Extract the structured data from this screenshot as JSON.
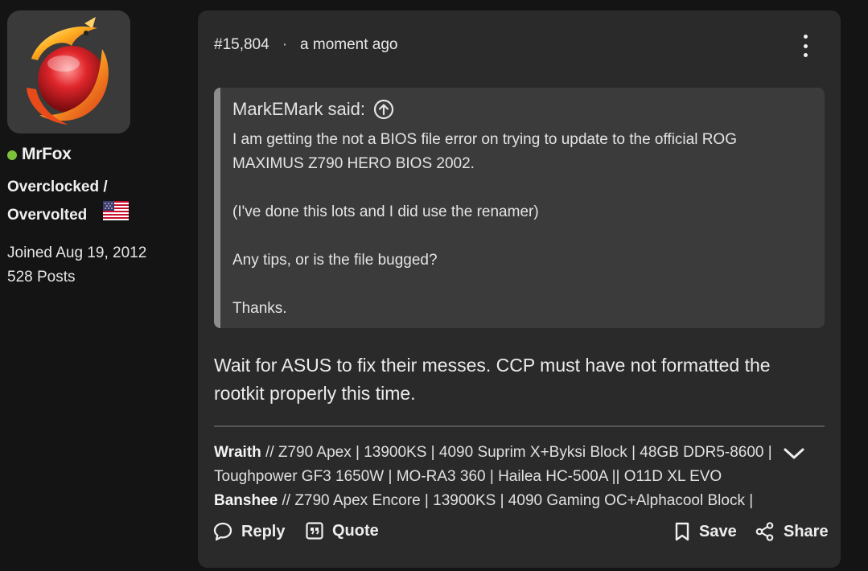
{
  "user": {
    "username": "MrFox",
    "online": true,
    "rank_line1": "Overclocked /",
    "rank_line2": "Overvolted",
    "joined": "Joined Aug 19, 2012",
    "posts": "528 Posts"
  },
  "post": {
    "number": "#15,804",
    "separator": "·",
    "time": "a moment ago",
    "quote": {
      "author_said": "MarkEMark said:",
      "paragraphs": [
        "I am getting the not a BIOS file error on trying to update to the official ROG MAXIMUS Z790 HERO BIOS 2002.",
        "(I've done this lots and I did use the renamer)",
        "Any tips, or is the file bugged?",
        "Thanks."
      ]
    },
    "reply": "Wait for ASUS to fix their messes. CCP must have not formatted the rootkit properly this time.",
    "signature": {
      "rig1_name": "Wraith",
      "rig1_specs": " // Z790 Apex | 13900KS | 4090 Suprim X+Byksi Block | 48GB DDR5-8600 | Toughpower GF3 1650W | MO-RA3 360 | Hailea HC-500A || O11D XL EVO",
      "rig2_name": "Banshee",
      "rig2_specs": " // Z790 Apex Encore | 13900KS | 4090 Gaming OC+Alphacool Block |"
    },
    "actions": {
      "reply": "Reply",
      "quote": "Quote",
      "save": "Save",
      "share": "Share"
    }
  },
  "colors": {
    "page_bg": "#141414",
    "card_bg": "#2a2a2b",
    "quote_bg": "#3b3b3c",
    "online": "#7cc23b"
  },
  "icons": [
    "avatar-fox-logo",
    "us-flag-icon",
    "more-vertical-icon",
    "arrow-up-circle-icon",
    "chevron-down-icon",
    "reply-bubble-icon",
    "quote-icon",
    "bookmark-icon",
    "share-icon"
  ]
}
